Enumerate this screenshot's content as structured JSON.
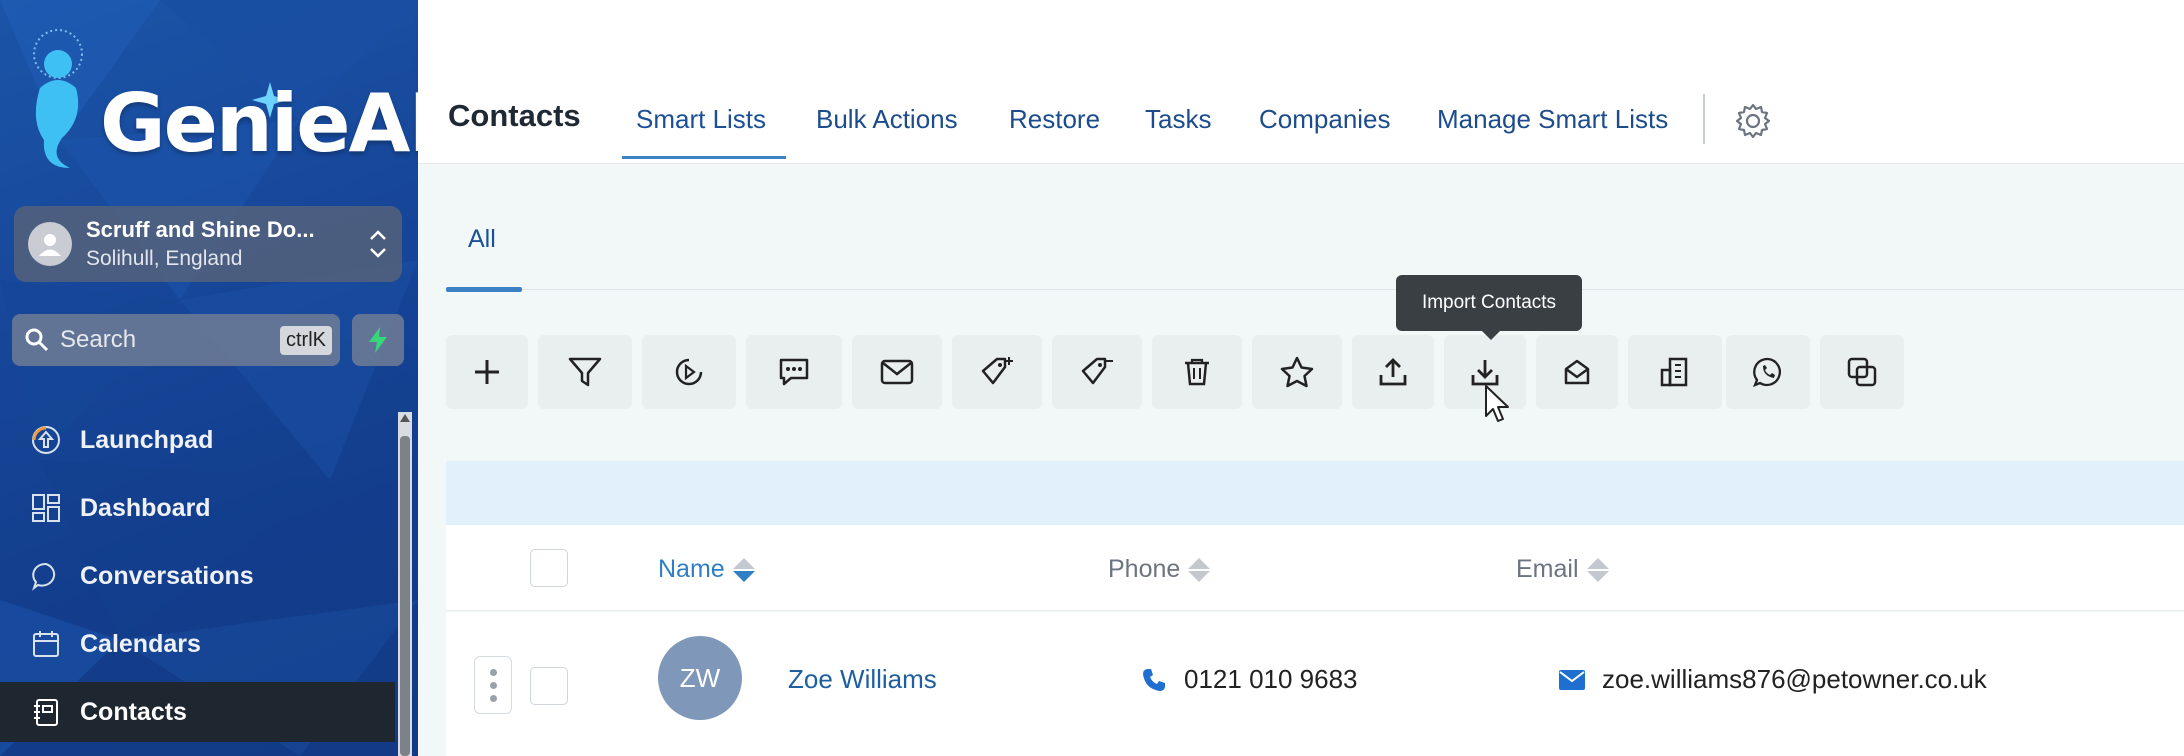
{
  "brand": {
    "logo_text": "GenieAI"
  },
  "location": {
    "name": "Scruff and Shine Do...",
    "place": "Solihull, England"
  },
  "search": {
    "placeholder": "Search",
    "shortcut": "ctrlK"
  },
  "nav": {
    "items": [
      {
        "label": "Launchpad",
        "icon": "launchpad-icon"
      },
      {
        "label": "Dashboard",
        "icon": "dashboard-icon"
      },
      {
        "label": "Conversations",
        "icon": "chat-icon"
      },
      {
        "label": "Calendars",
        "icon": "calendar-icon"
      },
      {
        "label": "Contacts",
        "icon": "contacts-icon",
        "active": true
      }
    ]
  },
  "header": {
    "title": "Contacts",
    "tabs": [
      "Smart Lists",
      "Bulk Actions",
      "Restore",
      "Tasks",
      "Companies",
      "Manage Smart Lists"
    ],
    "active_tab": "Smart Lists"
  },
  "subtabs": {
    "all": "All"
  },
  "toolbar": {
    "buttons": [
      "add-icon",
      "filter-icon",
      "automation-icon",
      "sms-icon",
      "email-icon",
      "add-tag-icon",
      "remove-tag-icon",
      "delete-icon",
      "star-icon",
      "export-icon",
      "import-icon",
      "mailbox-icon",
      "company-icon",
      "whatsapp-icon",
      "merge-icon"
    ],
    "tooltip": "Import Contacts"
  },
  "table": {
    "columns": {
      "name": "Name",
      "phone": "Phone",
      "email": "Email"
    },
    "rows": [
      {
        "initials": "ZW",
        "name": "Zoe Williams",
        "phone": "0121 010 9683",
        "email": "zoe.williams876@petowner.co.uk"
      }
    ]
  },
  "colors": {
    "accent": "#1b4f96",
    "sidebar": "#17479a",
    "content_bg": "#f1f8f7",
    "active_nav": "#1e2630"
  }
}
